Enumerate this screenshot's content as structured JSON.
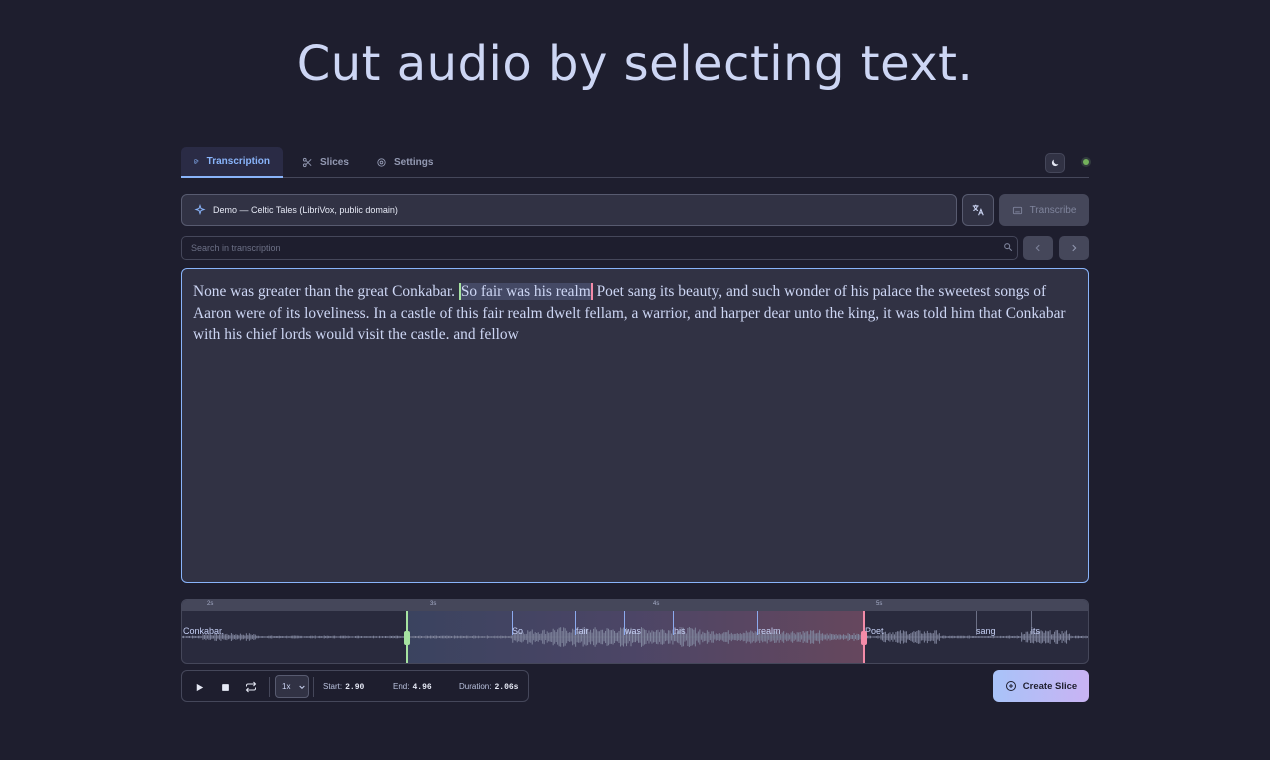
{
  "hero": {
    "title": "Cut audio by selecting text."
  },
  "tabs": [
    {
      "label": "Transcription",
      "icon": "edit-icon",
      "active": true
    },
    {
      "label": "Slices",
      "icon": "scissors-icon",
      "active": false
    },
    {
      "label": "Settings",
      "icon": "gear-icon",
      "active": false
    }
  ],
  "source": {
    "selected": "Demo — Celtic Tales (LibriVox, public domain)"
  },
  "transcribe_label": "Transcribe",
  "search": {
    "placeholder": "Search in transcription"
  },
  "transcript": {
    "before": "None was greater than the great Conkabar. ",
    "selected": "So fair was his realm",
    "after": " Poet sang its beauty, and such wonder of his palace the sweetest songs of Aaron were of its loveliness. In a castle of this fair realm dwelt fellam, a warrior, and harper dear unto the king, it was told him that Conkabar with his chief lords would visit the castle. and fellow"
  },
  "waveform": {
    "ticks": [
      "2s",
      "3s",
      "4s",
      "5s"
    ],
    "words": [
      "Conkabar,",
      "So",
      "fair",
      "was",
      "his",
      "realm",
      "Poet",
      "sang",
      "its"
    ]
  },
  "playback": {
    "speed": "1x",
    "start_label": "Start:",
    "start_value": "2.90",
    "end_label": "End:",
    "end_value": "4.96",
    "duration_label": "Duration:",
    "duration_value": "2.06s"
  },
  "create_slice_label": "Create Slice",
  "colors": {
    "background": "#1e1e2e",
    "accent": "#89b4fa",
    "selection_start": "#a6e3a1",
    "selection_end": "#f38ba8",
    "status_online": "#6aa84f"
  }
}
